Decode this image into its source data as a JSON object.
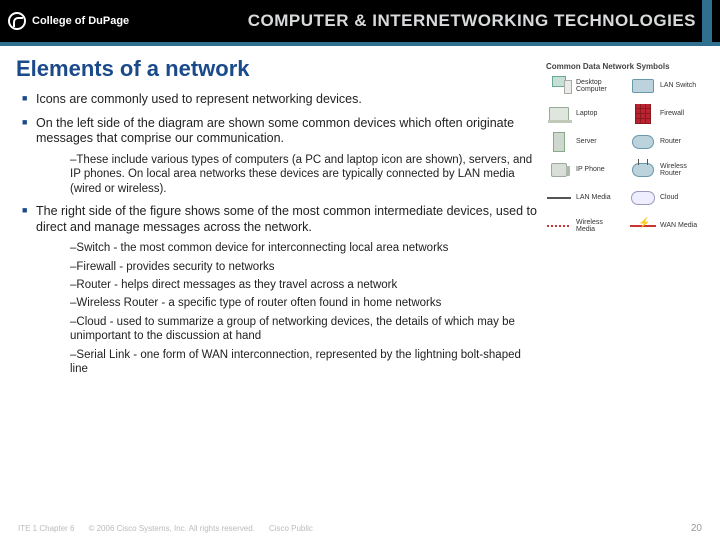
{
  "header": {
    "org": "College of DuPage",
    "title": "COMPUTER & INTERNETWORKING TECHNOLOGIES"
  },
  "slide": {
    "title": "Elements of a network",
    "bullets": [
      {
        "text": "Icons are commonly used to represent networking devices."
      },
      {
        "text": "On the left side of the diagram are shown some common devices which often originate messages that comprise our communication.",
        "subs": [
          "These include various types of computers (a PC and laptop icon are shown), servers, and IP phones. On local area networks these devices are typically connected by LAN media (wired or wireless)."
        ]
      },
      {
        "text": "The right side of the figure shows some of the most common intermediate devices, used to direct and manage messages across the network.",
        "subs": [
          "Switch - the most common device for interconnecting local area networks",
          "Firewall - provides security to networks",
          "Router - helps direct messages as they travel across a network",
          "Wireless Router - a specific type of router often found in home networks",
          "Cloud - used to summarize a group of networking devices, the details of which may be unimportant to the discussion at hand",
          "Serial Link - one form of WAN interconnection, represented by the lightning bolt-shaped line"
        ]
      }
    ]
  },
  "symbols": {
    "heading": "Common Data Network Symbols",
    "items": [
      {
        "label": "Desktop Computer"
      },
      {
        "label": "LAN Switch"
      },
      {
        "label": "Laptop"
      },
      {
        "label": "Firewall"
      },
      {
        "label": "Server"
      },
      {
        "label": "Router"
      },
      {
        "label": "IP Phone"
      },
      {
        "label": "Wireless Router"
      },
      {
        "label": "LAN Media"
      },
      {
        "label": "Cloud"
      },
      {
        "label": "Wireless Media"
      },
      {
        "label": "WAN Media"
      }
    ]
  },
  "footer": {
    "left": "ITE 1 Chapter 6",
    "copyright": "© 2006 Cisco Systems, Inc. All rights reserved.",
    "pub": "Cisco Public",
    "page": "20"
  }
}
